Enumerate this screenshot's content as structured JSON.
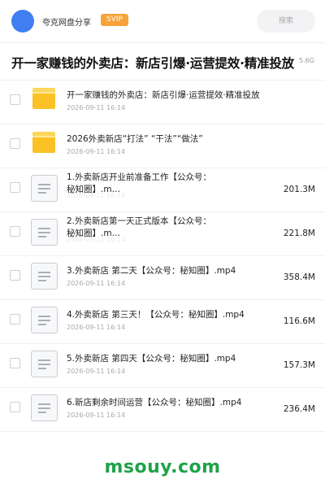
{
  "header": {
    "owner_name": "夸克网盘分享",
    "badge": "SVIP",
    "search_placeholder": "搜索"
  },
  "share": {
    "title": "开一家赚钱的外卖店：新店引爆·运营提效·精准投放",
    "total_size": "5.6G"
  },
  "files": [
    {
      "type": "folder",
      "name": "开一家赚钱的外卖店：新店引爆·运营提效·精准投放",
      "date": "2026-09-11 16:14",
      "size": ""
    },
    {
      "type": "folder",
      "name": "2026外卖新店“打法” “干法”“做法”",
      "date": "2026-09-11 16:14",
      "size": ""
    },
    {
      "type": "video",
      "name": "1.外卖新店开业前准备工作【公众号：秘知圈】.m…",
      "date": "2026-09-11 16:14",
      "size": "201.3M"
    },
    {
      "type": "video",
      "name": "2.外卖新店第一天正式版本【公众号：秘知圈】.m…",
      "date": "2026-09-11 16:14",
      "size": "221.8M"
    },
    {
      "type": "video",
      "name": "3.外卖新店 第二天【公众号：秘知圈】.mp4",
      "date": "2026-09-11 16:14",
      "size": "358.4M"
    },
    {
      "type": "video",
      "name": "4.外卖新店 第三天！【公众号：秘知圈】.mp4",
      "date": "2026-09-11 16:14",
      "size": "116.6M"
    },
    {
      "type": "video",
      "name": "5.外卖新店 第四天【公众号：秘知圈】.mp4",
      "date": "2026-09-11 16:14",
      "size": "157.3M"
    },
    {
      "type": "video",
      "name": "6.新店剩余时间运营【公众号：秘知圈】.mp4",
      "date": "2026-09-11 16:14",
      "size": "236.4M"
    }
  ],
  "watermark": "msouy.com",
  "colors": {
    "accent_blue": "#3f7ff2",
    "svip_orange": "#f7a23a",
    "folder_yellow": "#fbc226",
    "watermark_green": "#1fa24a"
  }
}
